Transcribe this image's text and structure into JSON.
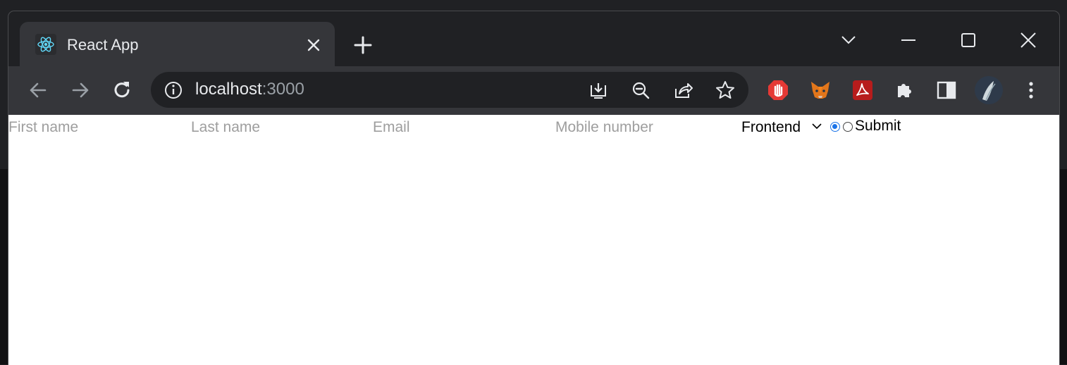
{
  "browser": {
    "tab": {
      "title": "React App",
      "favicon": "react-logo-icon"
    },
    "address_bar": {
      "host": "localhost",
      "port": ":3000"
    }
  },
  "form": {
    "first_name_placeholder": "First name",
    "last_name_placeholder": "Last name",
    "email_placeholder": "Email",
    "mobile_placeholder": "Mobile number",
    "select_value": "Frontend",
    "radio_selected_index": 0,
    "submit_label": "Submit"
  },
  "colors": {
    "window_bg": "#202124",
    "toolbar_bg": "#35363a",
    "radio_accent": "#1a73e8"
  }
}
